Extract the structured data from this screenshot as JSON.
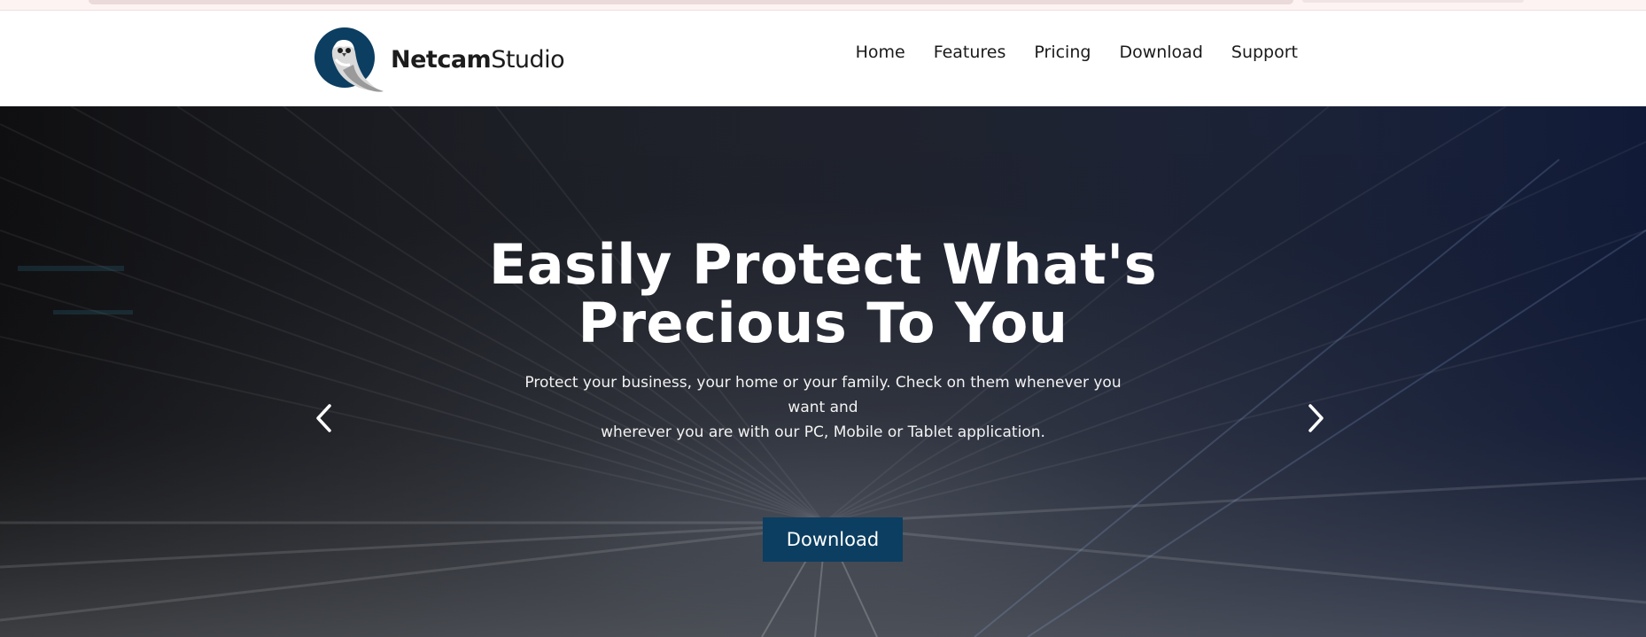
{
  "brand": {
    "name_strong": "Netcam",
    "name_light": "Studio",
    "logo_color": "#0b3e61"
  },
  "nav": {
    "items": [
      {
        "label": "Home"
      },
      {
        "label": "Features"
      },
      {
        "label": "Pricing"
      },
      {
        "label": "Download"
      },
      {
        "label": "Support"
      }
    ]
  },
  "hero": {
    "title_line1": "Easily Protect What's",
    "title_line2": "Precious To You",
    "subtitle_line1": "Protect your business, your home or your family. Check on them whenever you want and",
    "subtitle_line2": "wherever you are with our PC, Mobile or Tablet application.",
    "button_label": "Download",
    "button_color": "#0b3e61",
    "prev_icon": "chevron-left-icon",
    "next_icon": "chevron-right-icon"
  }
}
